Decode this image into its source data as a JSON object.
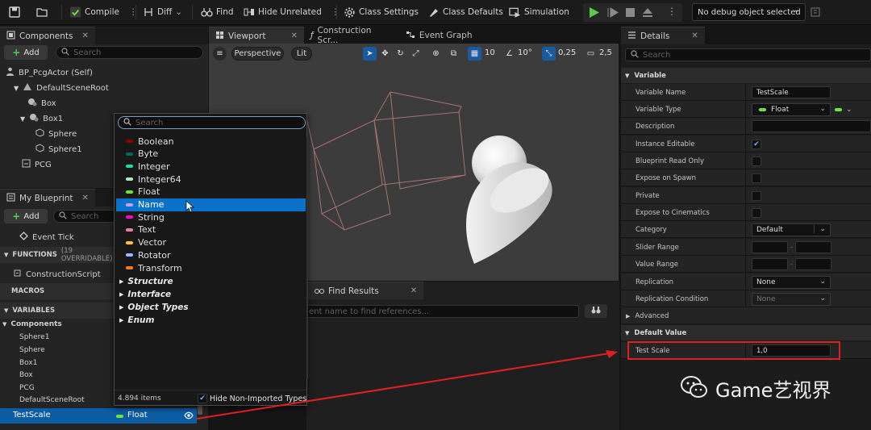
{
  "toolbar": {
    "compile": "Compile",
    "diff": "Diff",
    "find": "Find",
    "hide_unrelated": "Hide Unrelated",
    "class_settings": "Class Settings",
    "class_defaults": "Class Defaults",
    "simulation": "Simulation",
    "debug_object": "No debug object selected"
  },
  "components_panel": {
    "tab": "Components",
    "add": "Add",
    "search_placeholder": "Search",
    "items": [
      "BP_PcgActor (Self)",
      "DefaultSceneRoot",
      "Box",
      "Box1",
      "Sphere",
      "Sphere1",
      "PCG"
    ]
  },
  "my_blueprint": {
    "tab": "My Blueprint",
    "add": "Add",
    "search_placeholder": "Search",
    "event_tick": "Event Tick",
    "functions_label": "FUNCTIONS",
    "functions_count": "(19 OVERRIDABLE)",
    "construction_script": "ConstructionScript",
    "macros_label": "MACROS",
    "variables_label": "VARIABLES",
    "components_group": "Components",
    "component_vars": [
      "Sphere1",
      "Sphere",
      "Box1",
      "Box",
      "PCG",
      "DefaultSceneRoot"
    ],
    "selected_var": "TestScale",
    "selected_var_type": "Float"
  },
  "editor_tabs": {
    "viewport": "Viewport",
    "construction": "Construction Scr...",
    "event_graph": "Event Graph"
  },
  "viewport": {
    "perspective": "Perspective",
    "lit": "Lit",
    "grid_snap": "10",
    "rot_snap": "10°",
    "scale_snap": "0,25",
    "cam_speed": "2,5"
  },
  "type_picker": {
    "search_placeholder": "Search",
    "types": [
      {
        "name": "Boolean",
        "color": "#8b0000"
      },
      {
        "name": "Byte",
        "color": "#006a57"
      },
      {
        "name": "Integer",
        "color": "#1fd9a8"
      },
      {
        "name": "Integer64",
        "color": "#a6e8c0"
      },
      {
        "name": "Float",
        "color": "#6fe33c"
      },
      {
        "name": "Name",
        "color": "#c89cff"
      },
      {
        "name": "String",
        "color": "#ff00d4"
      },
      {
        "name": "Text",
        "color": "#e87ab0"
      },
      {
        "name": "Vector",
        "color": "#ffc81a"
      },
      {
        "name": "Rotator",
        "color": "#9fb4ff"
      },
      {
        "name": "Transform",
        "color": "#ff7a1a"
      }
    ],
    "selected_index": 5,
    "categories": [
      "Structure",
      "Interface",
      "Object Types",
      "Enum"
    ],
    "item_count": "4.894 items",
    "hide_label": "Hide Non-Imported Types"
  },
  "find_results": {
    "tab": "Find Results",
    "placeholder": "ent name to find references..."
  },
  "details": {
    "tab": "Details",
    "search_placeholder": "Search",
    "variable_section": "Variable",
    "variable_name_label": "Variable Name",
    "variable_name": "TestScale",
    "variable_type_label": "Variable Type",
    "variable_type": "Float",
    "description_label": "Description",
    "instance_editable_label": "Instance Editable",
    "bp_read_only_label": "Blueprint Read Only",
    "expose_spawn_label": "Expose on Spawn",
    "private_label": "Private",
    "expose_cinematics_label": "Expose to Cinematics",
    "category_label": "Category",
    "category": "Default",
    "slider_range_label": "Slider Range",
    "value_range_label": "Value Range",
    "replication_label": "Replication",
    "replication": "None",
    "replication_cond_label": "Replication Condition",
    "replication_cond": "None",
    "advanced_label": "Advanced",
    "default_value_section": "Default Value",
    "test_scale_label": "Test Scale",
    "test_scale_value": "1,0",
    "instance_editable_checked": true
  },
  "watermark": "Game艺视界",
  "colors": {
    "selection": "#0a72c9",
    "float_pin": "#6fe33c",
    "annotation": "#e02020"
  }
}
